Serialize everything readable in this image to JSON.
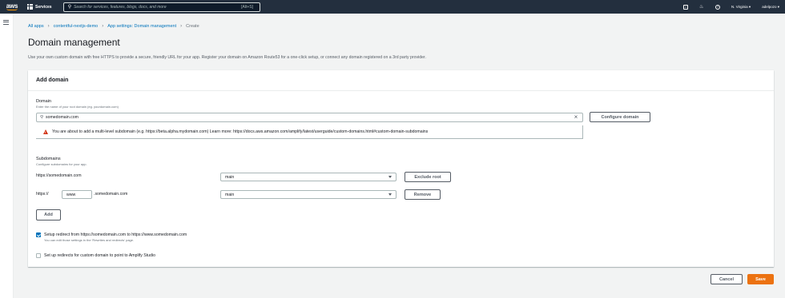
{
  "nav": {
    "logo": "aws",
    "services_label": "Services",
    "search_placeholder": "Search for services, features, blogs, docs, and more",
    "search_shortcut": "[Alt+S]",
    "region": "N. Virginia",
    "user": "adelpozo"
  },
  "breadcrumb": {
    "items": [
      "All apps",
      "contentful-nextjs-demo",
      "App settings: Domain management"
    ],
    "current": "Create"
  },
  "page": {
    "title": "Domain management",
    "description": "Use your own custom domain with free HTTPS to provide a secure, friendly URL for your app. Register your domain on Amazon Route53 for a one-click setup, or connect any domain registered on a 3rd party provider."
  },
  "panel": {
    "header": "Add domain",
    "domain_label": "Domain",
    "domain_hint": "Enter the name of your root domain (eg. yourdomain.com)",
    "domain_value": "somedomain.com",
    "configure_button": "Configure domain",
    "warning_text": "You are about to add a multi-level subdomain (e.g. https://beta.alpha.mydomain.com) Learn more: https://docs.aws.amazon.com/amplify/latest/userguide/custom-domains.html#custom-domain-subdomains",
    "subdomains_label": "Subdomains",
    "subdomains_hint": "Configure subdomains for your app.",
    "rows": [
      {
        "prefix": "https://somedomain.com",
        "branch": "main",
        "action": "Exclude root"
      },
      {
        "prefix": "https://",
        "sub_value": "www",
        "suffix": ".somedomain.com",
        "branch": "main",
        "action": "Remove"
      }
    ],
    "add_button": "Add",
    "redirect_label": "Setup redirect from https://somedomain.com to https://www.somedomain.com",
    "redirect_hint": "You can edit those settings in the 'Rewrites and redirects' page.",
    "redirect_checked": true,
    "studio_label": "Set up redirects for custom domain to point to Amplify Studio",
    "studio_checked": false
  },
  "footer": {
    "cancel": "Cancel",
    "save": "Save"
  }
}
